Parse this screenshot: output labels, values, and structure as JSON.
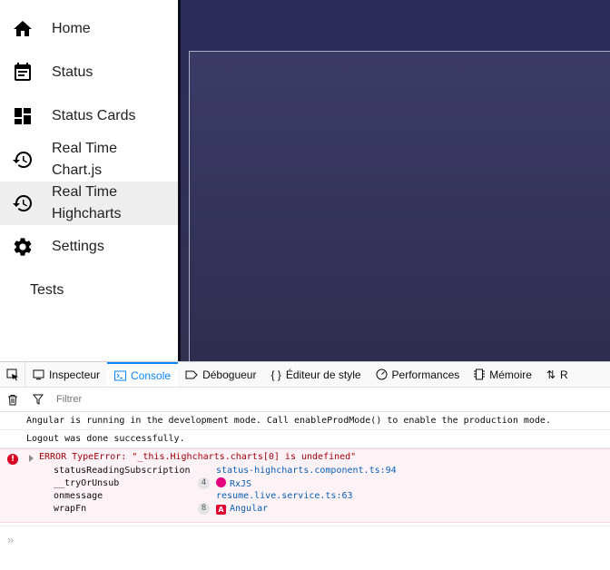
{
  "sidenav": {
    "items": [
      {
        "label": "Home",
        "icon": "home-icon"
      },
      {
        "label": "Status",
        "icon": "event-note-icon"
      },
      {
        "label": "Status Cards",
        "icon": "dashboard-icon"
      },
      {
        "label": "Real Time",
        "label2": "Chart.js",
        "icon": "history-icon"
      },
      {
        "label": "Real Time",
        "label2": "Highcharts",
        "icon": "history-icon",
        "active": true
      },
      {
        "label": "Settings",
        "icon": "gear-icon"
      },
      {
        "label": "Tests"
      }
    ]
  },
  "devtools": {
    "tabs": [
      {
        "label": "Inspecteur"
      },
      {
        "label": "Console",
        "active": true
      },
      {
        "label": "Débogueur"
      },
      {
        "label": "Éditeur de style"
      },
      {
        "label": "Performances"
      },
      {
        "label": "Mémoire"
      },
      {
        "label": "R"
      }
    ],
    "filter_placeholder": "Filtrer",
    "messages": [
      "Angular is running in the development mode. Call enableProdMode() to enable the production mode.",
      "Logout was done successfully."
    ],
    "error": {
      "message": "ERROR TypeError: \"_this.Highcharts.charts[0] is undefined\"",
      "frames": [
        {
          "fn": "statusReadingSubscription",
          "src": "status-highcharts.component.ts",
          "line": ":94"
        },
        {
          "fn": "__tryOrUnsub",
          "count": "4",
          "lib": "RxJS"
        },
        {
          "fn": "onmessage",
          "src": "resume.live.service.ts",
          "line": ":63"
        },
        {
          "fn": "wrapFn",
          "count": "8",
          "lib": "Angular"
        }
      ]
    },
    "prompt": "»"
  }
}
